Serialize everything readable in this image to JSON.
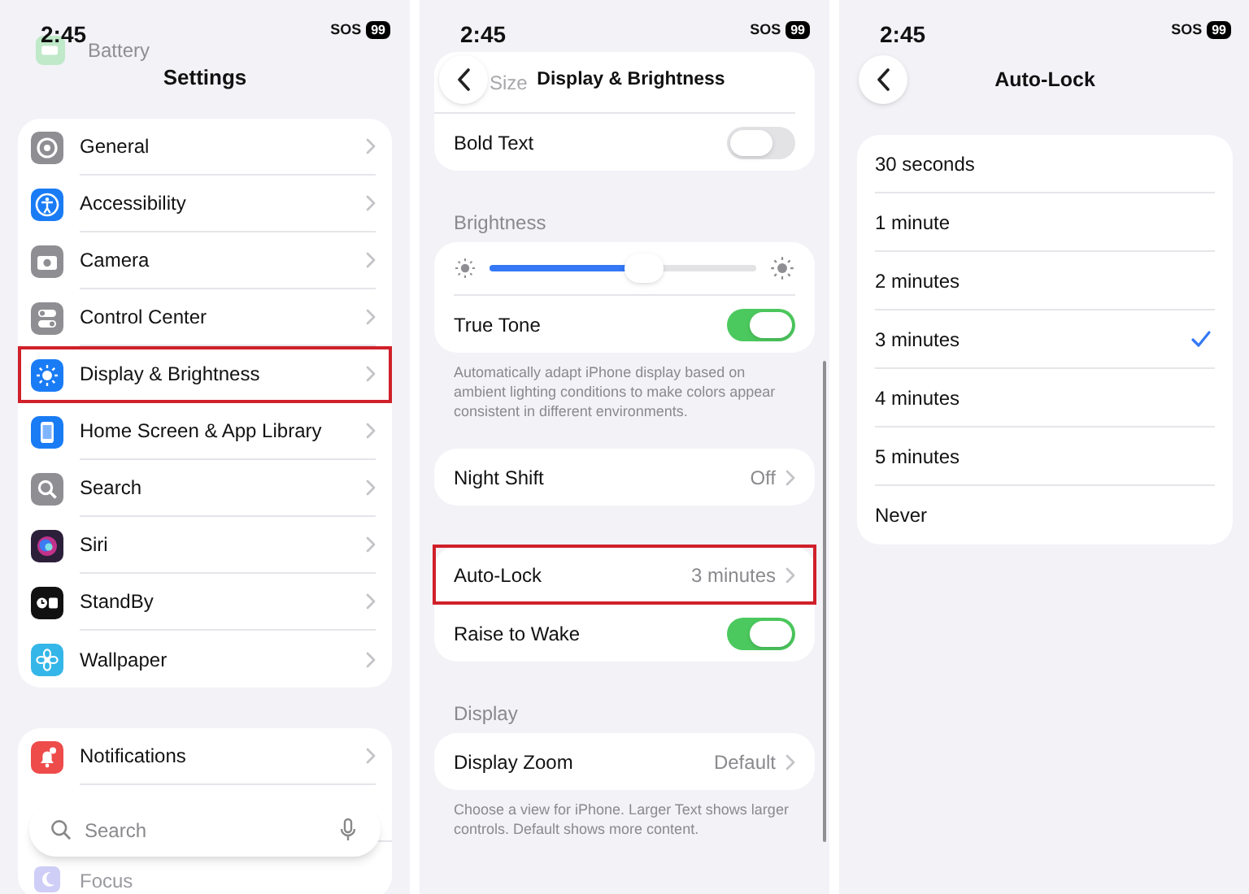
{
  "settings_screen": {
    "time": "2:45",
    "sos": "SOS",
    "battery": "99",
    "behind_header": {
      "label": "Battery",
      "color": "#bfe9c9"
    },
    "title": "Settings",
    "groups": [
      [
        {
          "label": "General",
          "color": "#8e8e93",
          "highlighted": false
        },
        {
          "label": "Accessibility",
          "color": "#1a7cf5",
          "highlighted": false
        },
        {
          "label": "Camera",
          "color": "#8e8e93",
          "highlighted": false
        },
        {
          "label": "Control Center",
          "color": "#8e8e93",
          "highlighted": false
        },
        {
          "label": "Display & Brightness",
          "color": "#1a7cf5",
          "highlighted": true
        },
        {
          "label": "Home Screen & App Library",
          "color": "#1a7cf5",
          "highlighted": false
        },
        {
          "label": "Search",
          "color": "#8e8e93",
          "highlighted": false
        },
        {
          "label": "Siri",
          "color": "#2b1f3a",
          "highlighted": false
        },
        {
          "label": "StandBy",
          "color": "#111111",
          "highlighted": false
        },
        {
          "label": "Wallpaper",
          "color": "#35b6e8",
          "highlighted": false
        }
      ],
      [
        {
          "label": "Notifications",
          "color": "#ee4b4b",
          "faded": false
        },
        {
          "label": "Focus",
          "color": "#cfcef7",
          "faded": true
        }
      ]
    ],
    "search": {
      "placeholder": "Search"
    }
  },
  "display_screen": {
    "time": "2:45",
    "sos": "SOS",
    "battery": "99",
    "title": "Display & Brightness",
    "behind_header": "Size",
    "sections": [
      {
        "rows": [
          {
            "kind": "toggle",
            "label": "Bold Text",
            "on": false,
            "highlighted": false
          }
        ]
      },
      {
        "header": "Brightness",
        "rows": [
          {
            "kind": "slider",
            "level": 0.58,
            "highlighted": false
          },
          {
            "kind": "toggle",
            "label": "True Tone",
            "on": true,
            "highlighted": false
          }
        ],
        "footer": "Automatically adapt iPhone display based on ambient lighting conditions to make colors appear consistent in different environments."
      },
      {
        "rows": [
          {
            "kind": "link",
            "label": "Night Shift",
            "value": "Off",
            "highlighted": false
          }
        ]
      },
      {
        "rows": [
          {
            "kind": "link",
            "label": "Auto-Lock",
            "value": "3 minutes",
            "highlighted": true
          },
          {
            "kind": "toggle",
            "label": "Raise to Wake",
            "on": true,
            "highlighted": false
          }
        ]
      },
      {
        "header": "Display",
        "rows": [
          {
            "kind": "link",
            "label": "Display Zoom",
            "value": "Default",
            "highlighted": false
          }
        ],
        "footer": "Choose a view for iPhone. Larger Text shows larger controls. Default shows more content."
      }
    ]
  },
  "autolock_screen": {
    "time": "2:45",
    "sos": "SOS",
    "battery": "99",
    "title": "Auto-Lock",
    "options": [
      {
        "label": "30 seconds",
        "selected": false
      },
      {
        "label": "1 minute",
        "selected": false
      },
      {
        "label": "2 minutes",
        "selected": false
      },
      {
        "label": "3 minutes",
        "selected": true
      },
      {
        "label": "4 minutes",
        "selected": false
      },
      {
        "label": "5 minutes",
        "selected": false
      },
      {
        "label": "Never",
        "selected": false
      }
    ]
  }
}
